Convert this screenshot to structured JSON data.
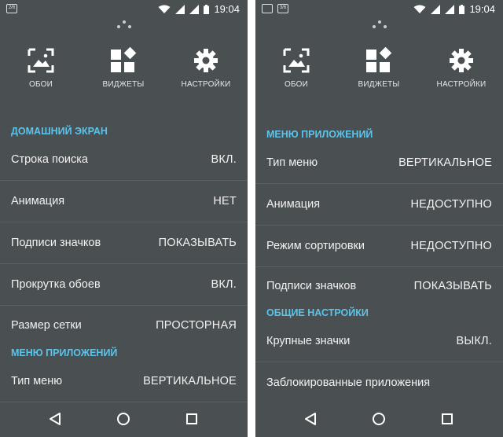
{
  "left": {
    "status": {
      "time": "19:04",
      "badge": "2/6"
    },
    "toolbar": [
      {
        "label": "ОБОИ",
        "icon": "wallpaper-icon"
      },
      {
        "label": "ВИДЖЕТЫ",
        "icon": "widgets-icon"
      },
      {
        "label": "НАСТРОЙКИ",
        "icon": "gear-icon"
      }
    ],
    "sections": [
      {
        "title": "ДОМАШНИЙ ЭКРАН",
        "items": [
          {
            "title": "Строка поиска",
            "value": "ВКЛ."
          },
          {
            "title": "Анимация",
            "value": "НЕТ"
          },
          {
            "title": "Подписи значков",
            "value": "ПОКАЗЫВАТЬ"
          },
          {
            "title": "Прокрутка обоев",
            "value": "ВКЛ."
          },
          {
            "title": "Размер сетки",
            "value": "ПРОСТОРНАЯ"
          }
        ]
      },
      {
        "title": "МЕНЮ ПРИЛОЖЕНИЙ",
        "items": [
          {
            "title": "Тип меню",
            "value": "ВЕРТИКАЛЬНОЕ"
          }
        ]
      }
    ]
  },
  "right": {
    "status": {
      "time": "19:04",
      "badge": "3/6"
    },
    "toolbar": [
      {
        "label": "ОБОИ",
        "icon": "wallpaper-icon"
      },
      {
        "label": "ВИДЖЕТЫ",
        "icon": "widgets-icon"
      },
      {
        "label": "НАСТРОЙКИ",
        "icon": "gear-icon"
      }
    ],
    "sections": [
      {
        "title": "МЕНЮ ПРИЛОЖЕНИЙ",
        "items": [
          {
            "title": "Тип меню",
            "value": "ВЕРТИКАЛЬНОЕ"
          },
          {
            "title": "Анимация",
            "value": "НЕДОСТУПНО"
          },
          {
            "title": "Режим сортировки",
            "value": "НЕДОСТУПНО"
          },
          {
            "title": "Подписи значков",
            "value": "ПОКАЗЫВАТЬ"
          }
        ]
      },
      {
        "title": "ОБЩИЕ НАСТРОЙКИ",
        "items": [
          {
            "title": "Крупные значки",
            "value": "ВЫКЛ."
          },
          {
            "title": "Заблокированные приложения",
            "value": ""
          }
        ]
      }
    ]
  },
  "colors": {
    "background": "#4a4f52",
    "accent": "#5cc4ea",
    "text": "#f2f2f2"
  }
}
